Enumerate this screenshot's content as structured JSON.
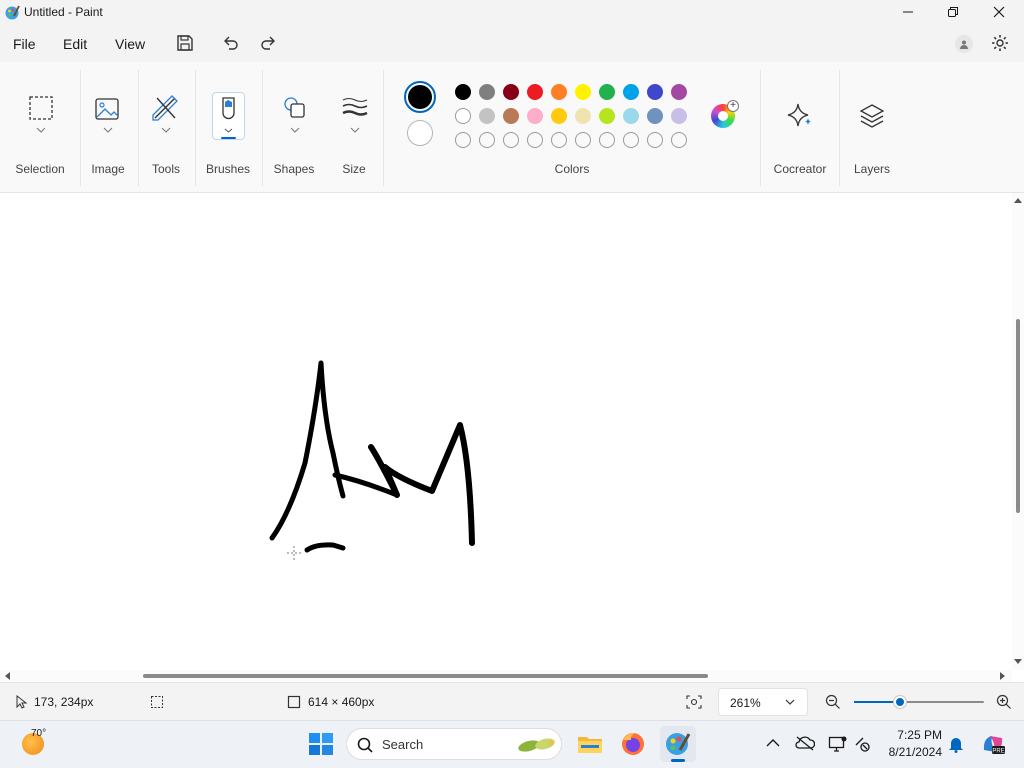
{
  "window": {
    "title": "Untitled - Paint"
  },
  "menu": {
    "file": "File",
    "edit": "Edit",
    "view": "View"
  },
  "ribbon": {
    "groups": {
      "selection": "Selection",
      "image": "Image",
      "tools": "Tools",
      "brushes": "Brushes",
      "shapes": "Shapes",
      "size": "Size",
      "colors": "Colors",
      "cocreator": "Cocreator",
      "layers": "Layers"
    },
    "primary_color": "#000000",
    "secondary_color": "#ffffff",
    "palette_row1": [
      "#000000",
      "#7f7f7f",
      "#880015",
      "#ed1c24",
      "#ff7f27",
      "#fff200",
      "#22b14c",
      "#00a2e8",
      "#3f48cc",
      "#a349a4"
    ],
    "palette_row2": [
      "#ffffff",
      "#c3c3c3",
      "#b97a57",
      "#ffaec9",
      "#ffc90e",
      "#efe4b0",
      "#b5e61d",
      "#99d9ea",
      "#7092be",
      "#c8bfe7"
    ],
    "palette_row3_count": 10
  },
  "status": {
    "cursor_pos": "173, 234px",
    "canvas_size": "614 × 460px",
    "zoom": "261%",
    "zoom_slider_fraction": 0.35
  },
  "taskbar": {
    "weather_temp": "70°",
    "search_placeholder": "Search",
    "clock_time": "7:25 PM",
    "clock_date": "8/21/2024"
  }
}
